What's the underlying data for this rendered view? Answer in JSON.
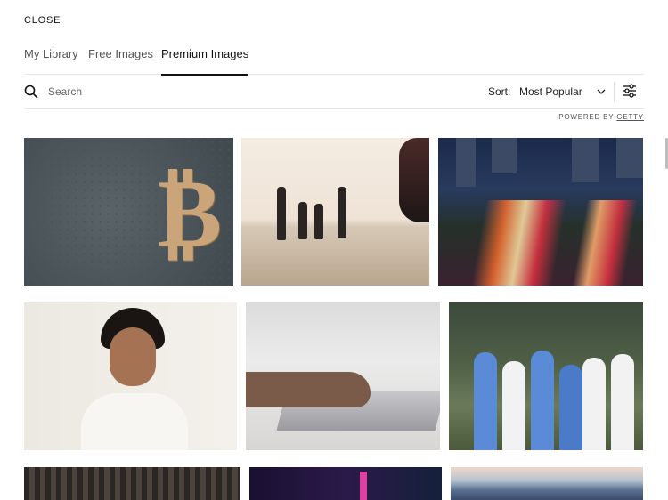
{
  "header": {
    "close_label": "CLOSE"
  },
  "tabs": [
    {
      "label": "My Library",
      "active": false
    },
    {
      "label": "Free Images",
      "active": false
    },
    {
      "label": "Premium Images",
      "active": true
    }
  ],
  "search": {
    "value": "",
    "placeholder": "Search"
  },
  "sort": {
    "label": "Sort:",
    "value": "Most Popular"
  },
  "powered_by": {
    "prefix": "POWERED BY",
    "brand": "GETTY"
  },
  "icons": {
    "search": "search-icon",
    "sort_chevron": "chevron-down-icon",
    "filters": "sliders-icon"
  },
  "colors": {
    "text": "#111111",
    "muted": "#666666",
    "border": "#e6e6e6",
    "active_underline": "#111111"
  },
  "images": [
    {
      "row": 1,
      "subject": "bitcoin-symbol"
    },
    {
      "row": 1,
      "subject": "family-on-beach"
    },
    {
      "row": 1,
      "subject": "city-highway-night"
    },
    {
      "row": 2,
      "subject": "portrait-woman"
    },
    {
      "row": 2,
      "subject": "hands-typing-laptop"
    },
    {
      "row": 2,
      "subject": "women-sports-team"
    },
    {
      "row": 3,
      "subject": "prison-bars"
    },
    {
      "row": 3,
      "subject": "city-at-night"
    },
    {
      "row": 3,
      "subject": "mountain-landscape"
    }
  ]
}
